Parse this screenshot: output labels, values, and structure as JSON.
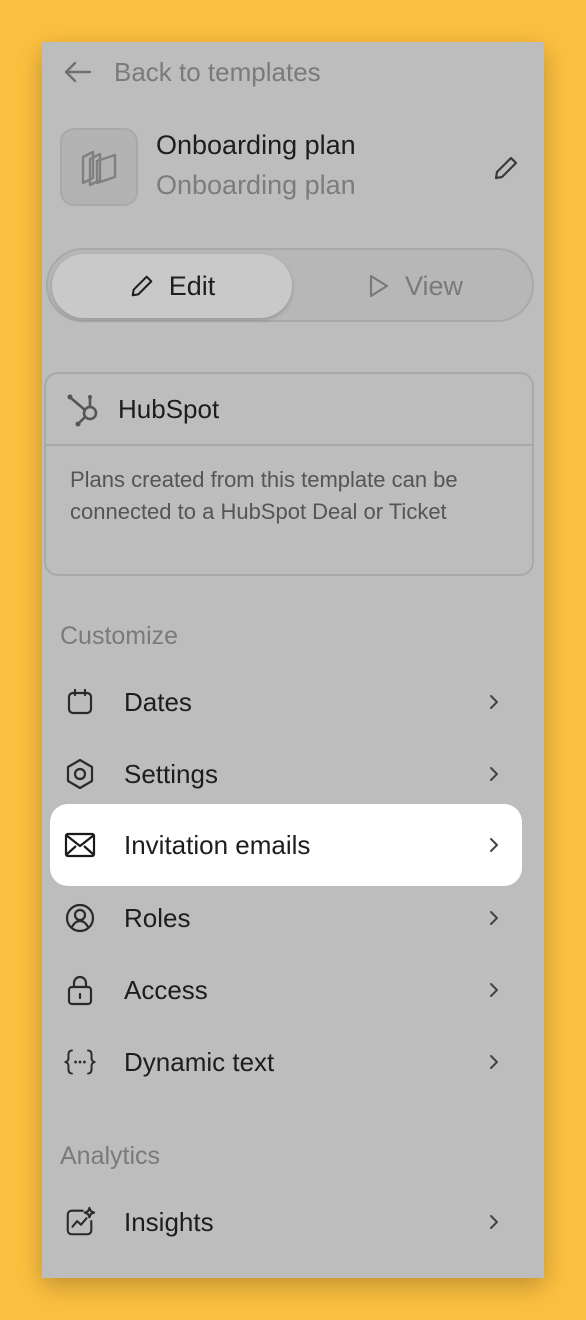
{
  "header": {
    "back_label": "Back to templates"
  },
  "template": {
    "name": "Onboarding plan",
    "subtitle": "Onboarding plan"
  },
  "mode_toggle": {
    "edit_label": "Edit",
    "view_label": "View",
    "selected": "Edit"
  },
  "integration": {
    "title": "HubSpot",
    "description": "Plans created from this template can be connected to a HubSpot Deal or Ticket"
  },
  "sections": {
    "customize": {
      "label": "Customize",
      "items": [
        {
          "label": "Dates",
          "icon": "calendar-icon"
        },
        {
          "label": "Settings",
          "icon": "gear-icon"
        },
        {
          "label": "Invitation emails",
          "icon": "envelope-icon",
          "active": true
        },
        {
          "label": "Roles",
          "icon": "user-circle-icon"
        },
        {
          "label": "Access",
          "icon": "lock-icon"
        },
        {
          "label": "Dynamic text",
          "icon": "braces-icon"
        }
      ]
    },
    "analytics": {
      "label": "Analytics",
      "items": [
        {
          "label": "Insights",
          "icon": "chart-sparkle-icon"
        }
      ]
    }
  },
  "colors": {
    "background": "#fcc040",
    "panel": "#bdbdbd",
    "active_item": "#ffffff"
  }
}
